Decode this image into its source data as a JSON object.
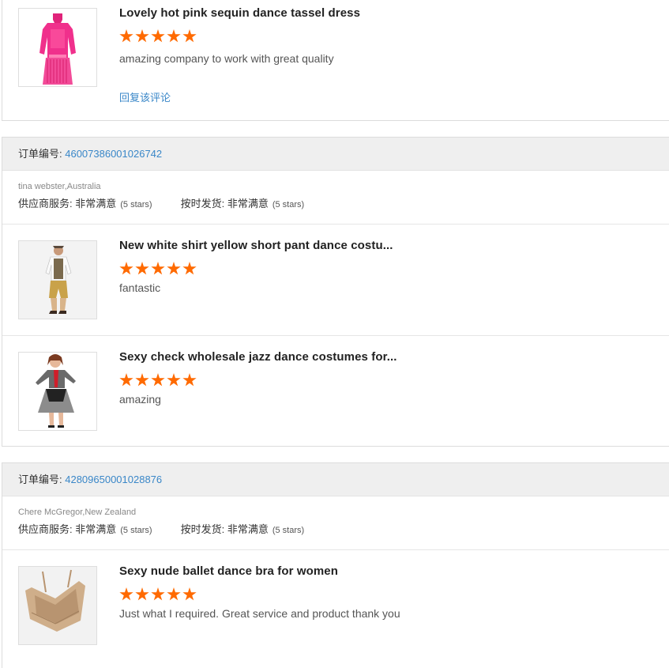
{
  "reviews": [
    {
      "order_label": "",
      "order_no": "",
      "items": [
        {
          "name": "Lovely hot pink sequin dance tassel dress",
          "rating": 5,
          "comment": "amazing company to work with great quality",
          "reply": "回复该评论",
          "image": "pink-sequin-dress"
        }
      ]
    },
    {
      "order_label": "订单编号: ",
      "order_no": "46007386001026742",
      "buyer": "tina webster,Australia",
      "supplier_label": "供应商服务: ",
      "supplier_value": "非常满意",
      "supplier_stars": "(5 stars)",
      "shipping_label": "按时发货: ",
      "shipping_value": "非常满意",
      "shipping_stars": "(5 stars)",
      "items": [
        {
          "name": "New white shirt yellow short pant dance costu...",
          "rating": 5,
          "comment": "fantastic",
          "image": "shirt-shorts-costume"
        },
        {
          "name": "Sexy check wholesale jazz dance costumes for...",
          "rating": 5,
          "comment": "amazing",
          "image": "jazz-check-costume"
        }
      ]
    },
    {
      "order_label": "订单编号: ",
      "order_no": "42809650001028876",
      "buyer": "Chere McGregor,New Zealand",
      "supplier_label": "供应商服务: ",
      "supplier_value": "非常满意",
      "supplier_stars": "(5 stars)",
      "shipping_label": "按时发货: ",
      "shipping_value": "非常满意",
      "shipping_stars": "(5 stars)",
      "items": [
        {
          "name": "Sexy nude ballet dance bra for women",
          "rating": 5,
          "comment": "Just what I required. Great service and product thank you",
          "image": "nude-ballet-bra"
        }
      ]
    }
  ],
  "colors": {
    "star": "#ff6a00",
    "link": "#3a87c8",
    "header_bg": "#efefef"
  }
}
